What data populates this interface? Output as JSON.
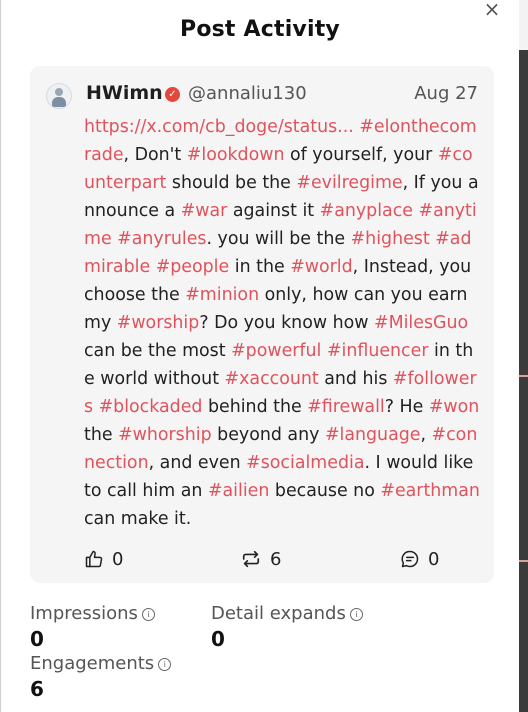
{
  "dialog": {
    "title": "Post Activity",
    "close_label": "×"
  },
  "post": {
    "author_name": "HWimn",
    "handle": "@annaliu130",
    "date": "Aug 27",
    "segments": [
      {
        "t": "https://x.com/cb_doge/status...",
        "tag": true
      },
      {
        "t": "  ",
        "tag": false
      },
      {
        "t": "#elonthecomrade",
        "tag": true
      },
      {
        "t": ", Don't ",
        "tag": false
      },
      {
        "t": "#lookdown",
        "tag": true
      },
      {
        "t": " of yourself, your ",
        "tag": false
      },
      {
        "t": "#counterpart",
        "tag": true
      },
      {
        "t": " should be the ",
        "tag": false
      },
      {
        "t": "#evilregime",
        "tag": true
      },
      {
        "t": ", If you announce a ",
        "tag": false
      },
      {
        "t": "#war",
        "tag": true
      },
      {
        "t": " against it ",
        "tag": false
      },
      {
        "t": "#anyplace",
        "tag": true
      },
      {
        "t": " ",
        "tag": false
      },
      {
        "t": "#anytime",
        "tag": true
      },
      {
        "t": " ",
        "tag": false
      },
      {
        "t": "#anyrules",
        "tag": true
      },
      {
        "t": ". you will be the ",
        "tag": false
      },
      {
        "t": "#highest",
        "tag": true
      },
      {
        "t": " ",
        "tag": false
      },
      {
        "t": "#admirable",
        "tag": true
      },
      {
        "t": " ",
        "tag": false
      },
      {
        "t": "#people",
        "tag": true
      },
      {
        "t": " in the ",
        "tag": false
      },
      {
        "t": "#world",
        "tag": true
      },
      {
        "t": ", Instead, you choose the ",
        "tag": false
      },
      {
        "t": "#minion",
        "tag": true
      },
      {
        "t": " only, how can you earn my ",
        "tag": false
      },
      {
        "t": "#worship",
        "tag": true
      },
      {
        "t": "? Do you know how ",
        "tag": false
      },
      {
        "t": "#MilesGuo",
        "tag": true
      },
      {
        "t": " can be the most ",
        "tag": false
      },
      {
        "t": "#powerful",
        "tag": true
      },
      {
        "t": " ",
        "tag": false
      },
      {
        "t": "#influencer",
        "tag": true
      },
      {
        "t": " in the world without ",
        "tag": false
      },
      {
        "t": "#xaccount",
        "tag": true
      },
      {
        "t": " and his ",
        "tag": false
      },
      {
        "t": "#followers",
        "tag": true
      },
      {
        "t": " ",
        "tag": false
      },
      {
        "t": "#blockaded",
        "tag": true
      },
      {
        "t": " behind the ",
        "tag": false
      },
      {
        "t": "#firewall",
        "tag": true
      },
      {
        "t": "? He ",
        "tag": false
      },
      {
        "t": "#won",
        "tag": true
      },
      {
        "t": " the ",
        "tag": false
      },
      {
        "t": "#whorship",
        "tag": true
      },
      {
        "t": " beyond any ",
        "tag": false
      },
      {
        "t": "#language",
        "tag": true
      },
      {
        "t": ", ",
        "tag": false
      },
      {
        "t": "#connection",
        "tag": true
      },
      {
        "t": ", and even ",
        "tag": false
      },
      {
        "t": "#socialmedia",
        "tag": true
      },
      {
        "t": ". I would like to call him an ",
        "tag": false
      },
      {
        "t": "#ailien",
        "tag": true
      },
      {
        "t": " because no ",
        "tag": false
      },
      {
        "t": "#earthman",
        "tag": true
      },
      {
        "t": " can make it.",
        "tag": false
      }
    ],
    "likes": "0",
    "reposts": "6",
    "replies": "0"
  },
  "stats": {
    "impressions_label": "Impressions",
    "impressions_value": "0",
    "detail_expands_label": "Detail expands",
    "detail_expands_value": "0",
    "engagements_label": "Engagements",
    "engagements_value": "6"
  },
  "colors": {
    "hashtag": "#e0535d",
    "card_bg": "#f5f5f5",
    "verified": "#e2483c"
  },
  "icons": {
    "close": "close-icon",
    "verified": "verified-badge-icon",
    "like": "thumbs-up-icon",
    "repost": "repost-icon",
    "reply": "comment-icon",
    "info": "info-icon"
  }
}
